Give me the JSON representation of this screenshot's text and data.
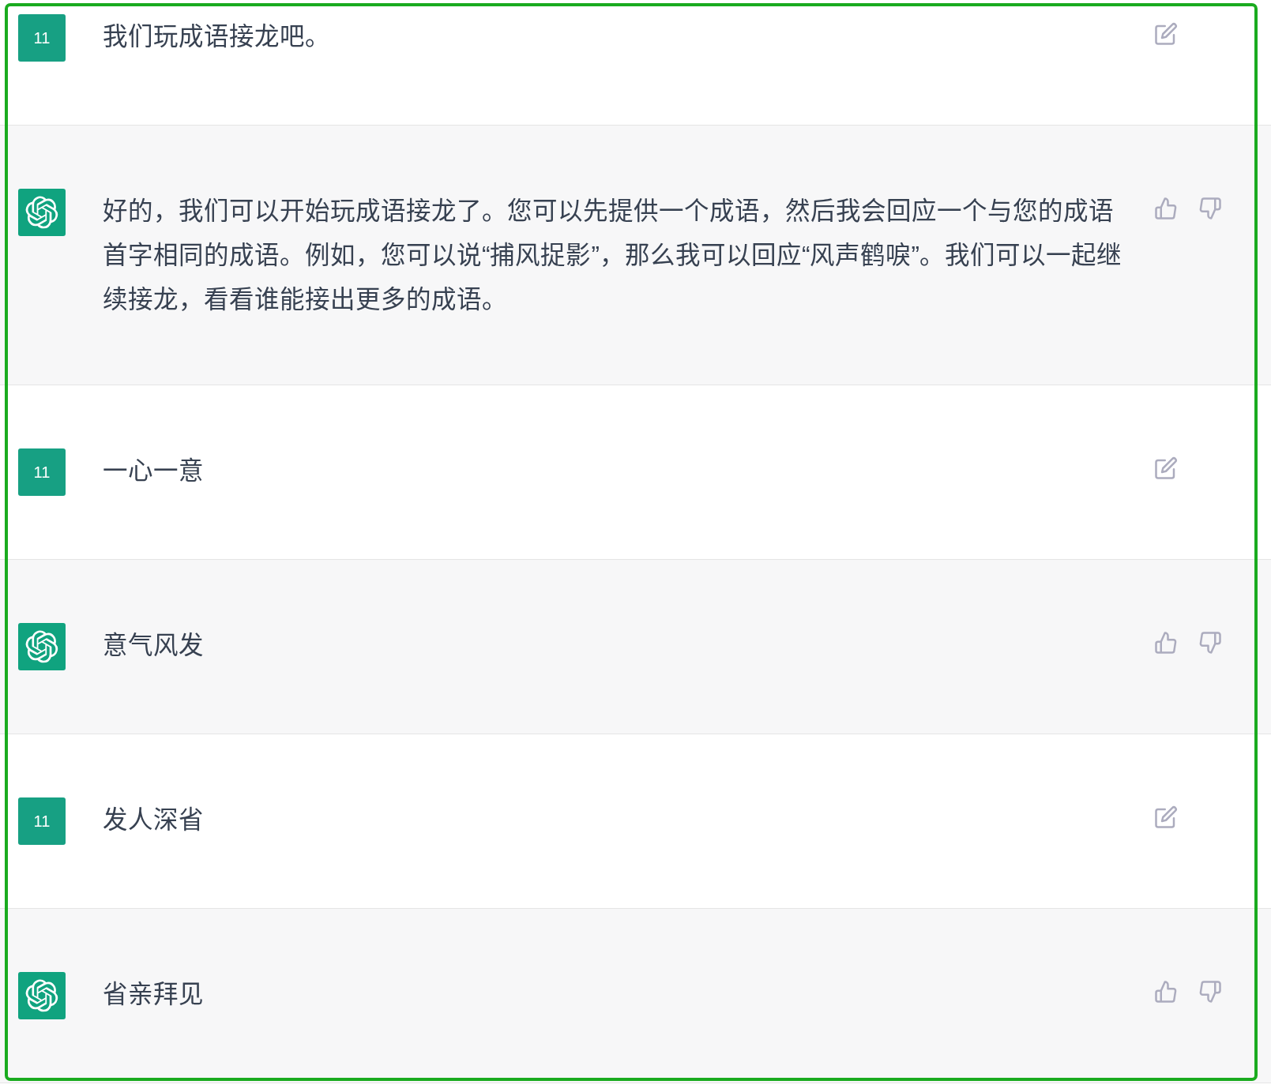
{
  "messages": [
    {
      "kind": "user",
      "avatar_text": "11",
      "text": "我们玩成语接龙吧。"
    },
    {
      "kind": "assistant",
      "text": "好的，我们可以开始玩成语接龙了。您可以先提供一个成语，然后我会回应一个与您的成语首字相同的成语。例如，您可以说“捕风捉影”，那么我可以回应“风声鹤唳”。我们可以一起继续接龙，看看谁能接出更多的成语。"
    },
    {
      "kind": "user",
      "avatar_text": "11",
      "text": "一心一意"
    },
    {
      "kind": "assistant",
      "text": "意气风发"
    },
    {
      "kind": "user",
      "avatar_text": "11",
      "text": "发人深省"
    },
    {
      "kind": "assistant",
      "text": "省亲拜见"
    }
  ]
}
